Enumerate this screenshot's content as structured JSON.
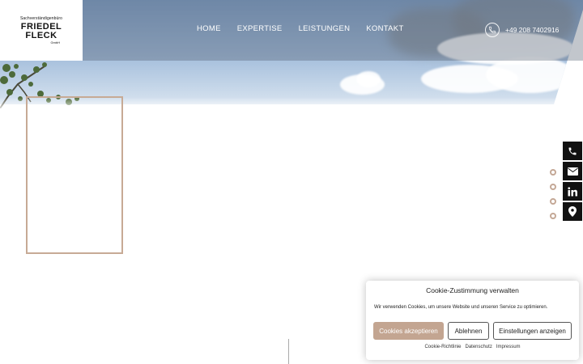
{
  "logo": {
    "tagline": "Sachverständigenbüro",
    "line1": "FRIEDEL",
    "line2": "FLECK",
    "suffix": "GmbH"
  },
  "nav": {
    "items": [
      {
        "label": "HOME"
      },
      {
        "label": "EXPERTISE"
      },
      {
        "label": "LEISTUNGEN"
      },
      {
        "label": "KONTAKT"
      }
    ]
  },
  "header_phone": {
    "icon": "phone-icon",
    "number": "+49 208 7402916"
  },
  "side_contact": {
    "items": [
      {
        "icon": "phone-icon"
      },
      {
        "icon": "envelope-icon"
      },
      {
        "icon": "linkedin-icon"
      },
      {
        "icon": "map-marker-icon"
      }
    ]
  },
  "slider_dots": {
    "count": 4
  },
  "cookie_banner": {
    "title": "Cookie-Zustimmung verwalten",
    "text": "Wir verwenden Cookies, um unsere Website und unseren Service zu optimieren.",
    "accept_label": "Cookies akzeptieren",
    "deny_label": "Ablehnen",
    "settings_label": "Einstellungen anzeigen",
    "links": [
      {
        "label": "Cookie-Richtlinie"
      },
      {
        "label": "Datenschutz"
      },
      {
        "label": "Impressum"
      }
    ]
  },
  "colors": {
    "accent": "#c3a591",
    "dark": "#111111"
  }
}
